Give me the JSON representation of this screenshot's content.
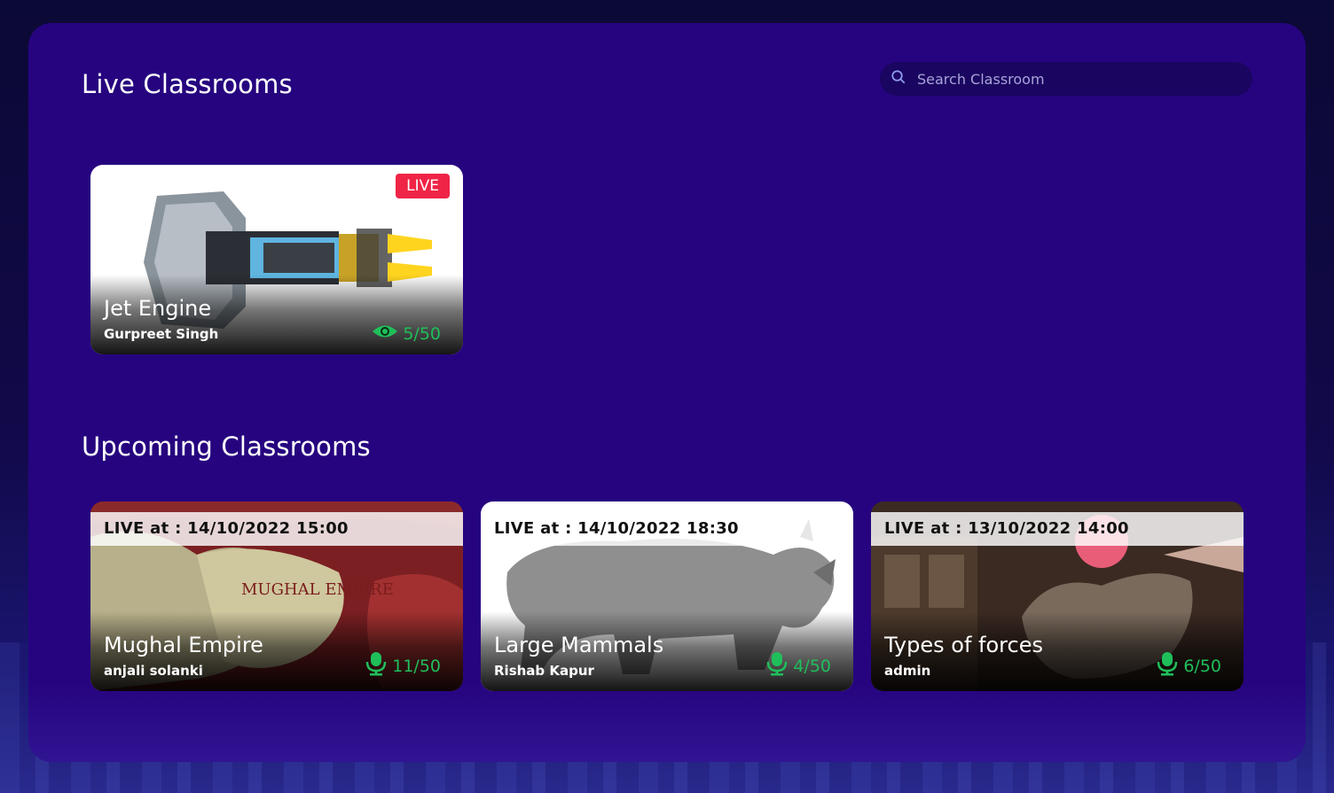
{
  "live_section": {
    "title": "Live Classrooms"
  },
  "search": {
    "placeholder": "Search Classroom",
    "icon": "search-icon"
  },
  "live_classrooms": [
    {
      "title": "Jet Engine",
      "teacher": "Gurpreet Singh",
      "badge": "LIVE",
      "count": "5/50",
      "count_icon": "eye-icon"
    }
  ],
  "upcoming_section": {
    "title": "Upcoming Classrooms"
  },
  "upcoming_classrooms": [
    {
      "schedule": "LIVE at : 14/10/2022 15:00",
      "title": "Mughal Empire",
      "teacher": "anjali solanki",
      "count": "11/50",
      "count_icon": "microphone-icon",
      "image_text": "MUGHAL EMPIRE"
    },
    {
      "schedule": "LIVE at : 14/10/2022 18:30",
      "title": "Large Mammals",
      "teacher": "Rishab Kapur",
      "count": "4/50",
      "count_icon": "microphone-icon"
    },
    {
      "schedule": "LIVE at : 13/10/2022 14:00",
      "title": "Types of forces",
      "teacher": "admin",
      "count": "6/50",
      "count_icon": "microphone-icon"
    }
  ],
  "colors": {
    "panel": "#26047f",
    "live_badge": "#ef2446",
    "count_green": "#1fbf5a"
  }
}
